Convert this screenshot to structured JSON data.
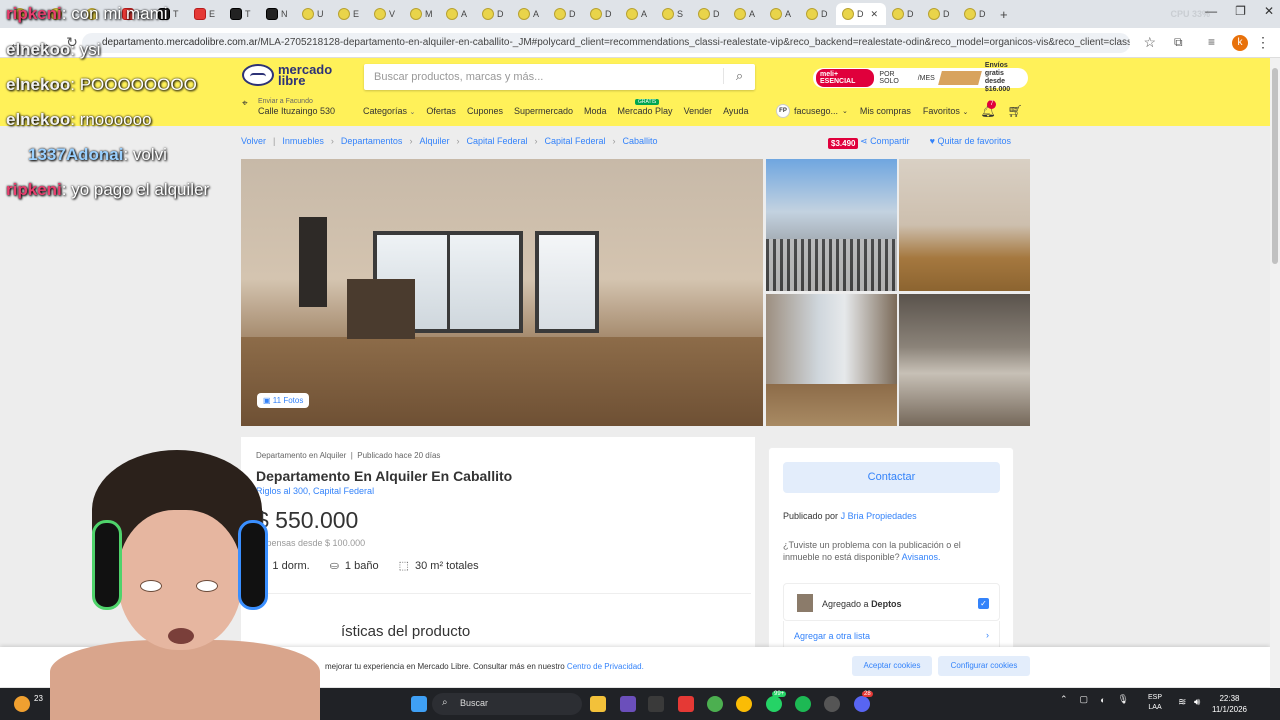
{
  "browser": {
    "tab_letters": [
      "",
      "",
      "",
      "E",
      "T",
      "E",
      "T",
      "N",
      "U",
      "E",
      "V",
      "M",
      "A",
      "D",
      "A",
      "D",
      "D",
      "A",
      "S",
      "D",
      "A",
      "A",
      "D",
      "D",
      "D",
      "D"
    ],
    "active_tab": "D",
    "cpu": "CPU 33%",
    "url_host": "departamento.mercadolibre.com.ar",
    "url_path": "/MLA-2705218128-departamento-en-alquiler-en-caballito-_JM#polycard_client=recommendations_classi-realestate-vip&reco_backend=realestate-odin&reco_model=organicos-vis&reco_client=classi-realestate-vi...",
    "profile_initial": "k"
  },
  "header": {
    "logo_line1": "mercado",
    "logo_line2": "libre",
    "search_placeholder": "Buscar productos, marcas y más...",
    "promo": {
      "meli": "meli+ ESENCIAL",
      "por_solo": "POR SOLO",
      "price": "$3.490",
      "per": "/MES",
      "ship1": "Envíos gratis",
      "ship2": "desde $16.000"
    },
    "location_label": "Enviar a Facundo",
    "location_address": "Calle Ituzaingo 530",
    "nav": [
      "Categorías",
      "Ofertas",
      "Cupones",
      "Supermercado",
      "Moda",
      "Mercado Play",
      "Vender",
      "Ayuda"
    ],
    "gratis": "GRATIS",
    "user_initials": "FP",
    "user_name": "facusego...",
    "mis_compras": "Mis compras",
    "favoritos": "Favoritos",
    "notif_count": "7"
  },
  "breadcrumb": {
    "items": [
      "Volver",
      "Inmuebles",
      "Departamentos",
      "Alquiler",
      "Capital Federal",
      "Capital Federal",
      "Caballito"
    ],
    "share": "Compartir",
    "remove_fav": "Quitar de favoritos"
  },
  "gallery": {
    "photo_count": "11 Fotos"
  },
  "listing": {
    "subtitle": "Departamento en Alquiler",
    "published": "Publicado hace 20 días",
    "title": "Departamento En Alquiler En Caballito",
    "address": "Riglos al 300, Capital Federal",
    "price": "$ 550.000",
    "expensas": "Expensas desde $ 100.000",
    "bedrooms": "1 dorm.",
    "bathrooms": "1 baño",
    "area": "30 m² totales",
    "section_title": "ísticas del producto"
  },
  "sidebar": {
    "contact": "Contactar",
    "published_by_label": "Publicado por",
    "publisher": "J Bria Propiedades",
    "report_text": "¿Tuviste un problema con la publicación o el inmueble no está disponible?",
    "report_link": "Avisanos.",
    "added_label": "Agregado a",
    "added_list": "Deptos",
    "other_list": "Agregar a otra lista"
  },
  "cookie": {
    "message": "mejorar tu experiencia en Mercado Libre. Consultar más en nuestro",
    "link": "Centro de Privacidad.",
    "accept": "Aceptar cookies",
    "configure": "Configurar cookies"
  },
  "taskbar": {
    "search": "Buscar",
    "lang1": "ESP",
    "lang2": "LAA",
    "time": "22:38",
    "date": "11/1/2026",
    "weather": "23",
    "chrome_badge": "99+",
    "discord_badge": "28"
  },
  "chat": [
    {
      "user": "ripkeni",
      "text": ": con mi mami"
    },
    {
      "user": "elnekoo",
      "text": ": ysi"
    },
    {
      "user": "elnekoo",
      "text": ": POOOOOOOO"
    },
    {
      "user": "elnekoo",
      "text": ": rnoooooo"
    },
    {
      "user": "1337Adonai",
      "text": ": volvi"
    },
    {
      "user": "ripkeni",
      "text": ": yo pago el alquiler"
    }
  ],
  "colors": {
    "ml_yellow": "#fff159",
    "ml_blue": "#3483fa",
    "chat_red": "#e83f6f"
  }
}
